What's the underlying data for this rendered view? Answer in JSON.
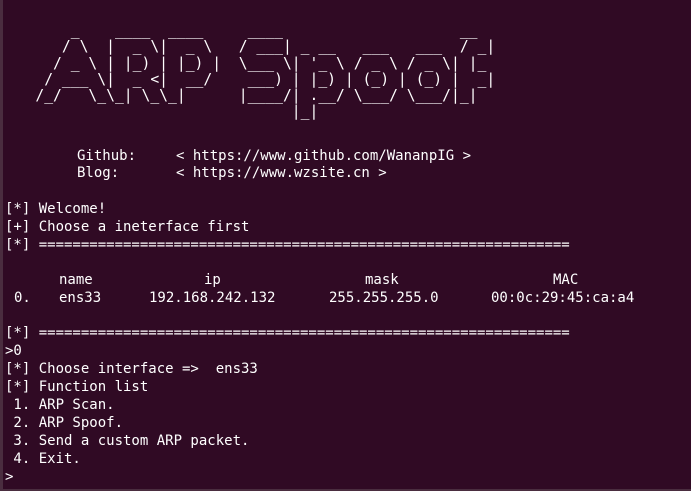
{
  "banner": {
    "art_lines": [
      "        _    ____  ____     ____                    __",
      "       / \\  |  _ \\|  _ \\   / ___| _ __   ___   ___  / _|",
      "      / _ \\ | |_) | |_) |  \\___ \\| '_ \\ / _ \\ / _ \\| |_",
      "     / ___ \\|  _ <|  __/    ___) | |_) | (_) | (_) |  _|",
      "    /_/   \\_\\_| \\_\\_|      |____/| .__/ \\___/ \\___/|_|",
      "                                 |_|"
    ],
    "github_label": "Github:",
    "github_value": "< https://www.github.com/WananpIG >",
    "blog_label": "Blog:",
    "blog_value": "< https://www.wzsite.cn >"
  },
  "messages": {
    "welcome": "[*] Welcome!",
    "choose_interface": "[+] Choose a ineterface first",
    "separator_top": "[*] ===============================================================",
    "separator_bottom": "[*] ==============================================================="
  },
  "interfaces": {
    "headers": {
      "name": "name",
      "ip": "ip",
      "mask": "mask",
      "mac": "MAC"
    },
    "rows": [
      {
        "index": "0.",
        "name": "ens33",
        "ip": "192.168.242.132",
        "mask": "255.255.255.0",
        "mac": "00:0c:29:45:ca:a4"
      }
    ]
  },
  "session": {
    "input_1": ">0",
    "chosen": "[*] Choose interface =>  ens33",
    "function_list": "[*] Function list",
    "menu_items": [
      " 1. ARP Scan.",
      " 2. ARP Spoof.",
      " 3. Send a custom ARP packet.",
      " 4. Exit."
    ],
    "prompt": ">"
  },
  "colors": {
    "background": "#300a24",
    "text": "#ffffff"
  }
}
